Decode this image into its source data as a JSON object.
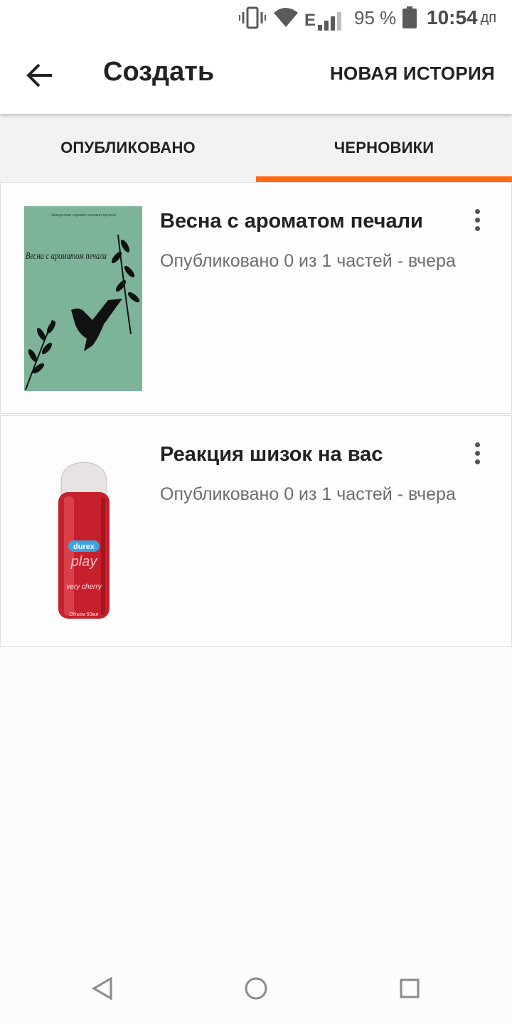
{
  "status_bar": {
    "network_type": "E",
    "battery_percent": "95 %",
    "time": "10:54",
    "ampm": "дп",
    "icons": [
      "vibrate-icon",
      "wifi-icon",
      "cell-signal-icon",
      "battery-icon"
    ]
  },
  "toolbar": {
    "title": "Создать",
    "new_story_label": "НОВАЯ ИСТОРИЯ",
    "back_icon": "arrow-back-icon"
  },
  "tabs": [
    {
      "label": "ОПУБЛИКОВАНО",
      "selected": false
    },
    {
      "label": "ЧЕРНОВИКИ",
      "selected": true
    }
  ],
  "accent_color": "#ff6a13",
  "stories": [
    {
      "title": "Весна с ароматом печали",
      "meta": "Опубликовано 0 из 1 частей - вчера",
      "cover": {
        "kind": "book-cover",
        "background": "#7db499",
        "text_top": "Авторство скрыто ленивой тучкой",
        "text_title": "Весна с ароматом печали"
      }
    },
    {
      "title": "Реакция шизок на вас",
      "meta": "Опубликовано 0 из 1 частей - вчера",
      "cover": {
        "kind": "product-bottle",
        "brand": "durex",
        "product": "play",
        "flavor": "very cherry",
        "volume": "Объем 50мл"
      }
    }
  ],
  "nav_bar": {
    "icons": [
      "back-triangle-icon",
      "home-circle-icon",
      "recents-square-icon"
    ]
  }
}
